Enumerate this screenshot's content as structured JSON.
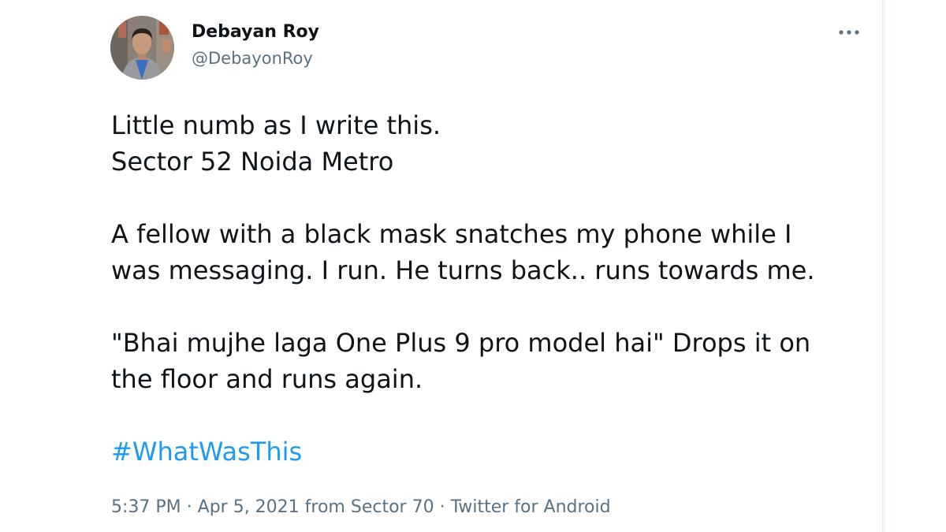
{
  "author": {
    "display_name": "Debayan Roy",
    "handle": "@DebayonRoy"
  },
  "tweet": {
    "line1": "Little numb as I write this.",
    "line2": "Sector 52 Noida Metro",
    "line3": "A fellow with a black mask snatches my phone while I",
    "line4": "was messaging. I run. He turns back.. runs towards me.",
    "line5": "\"Bhai mujhe laga One Plus 9 pro model hai\" Drops it on",
    "line6": "the floor and runs again.",
    "hashtag": "#WhatWasThis"
  },
  "meta": {
    "time": "5:37 PM",
    "sep1": " · ",
    "date": "Apr 5, 2021",
    "from_label": " from ",
    "location": "Sector 70",
    "sep2": " · ",
    "source": "Twitter for Android"
  },
  "colors": {
    "text": "#0f1419",
    "secondary": "#5b7083",
    "link": "#1d9bf0"
  },
  "icons": {
    "more": "more-horizontal-icon"
  }
}
